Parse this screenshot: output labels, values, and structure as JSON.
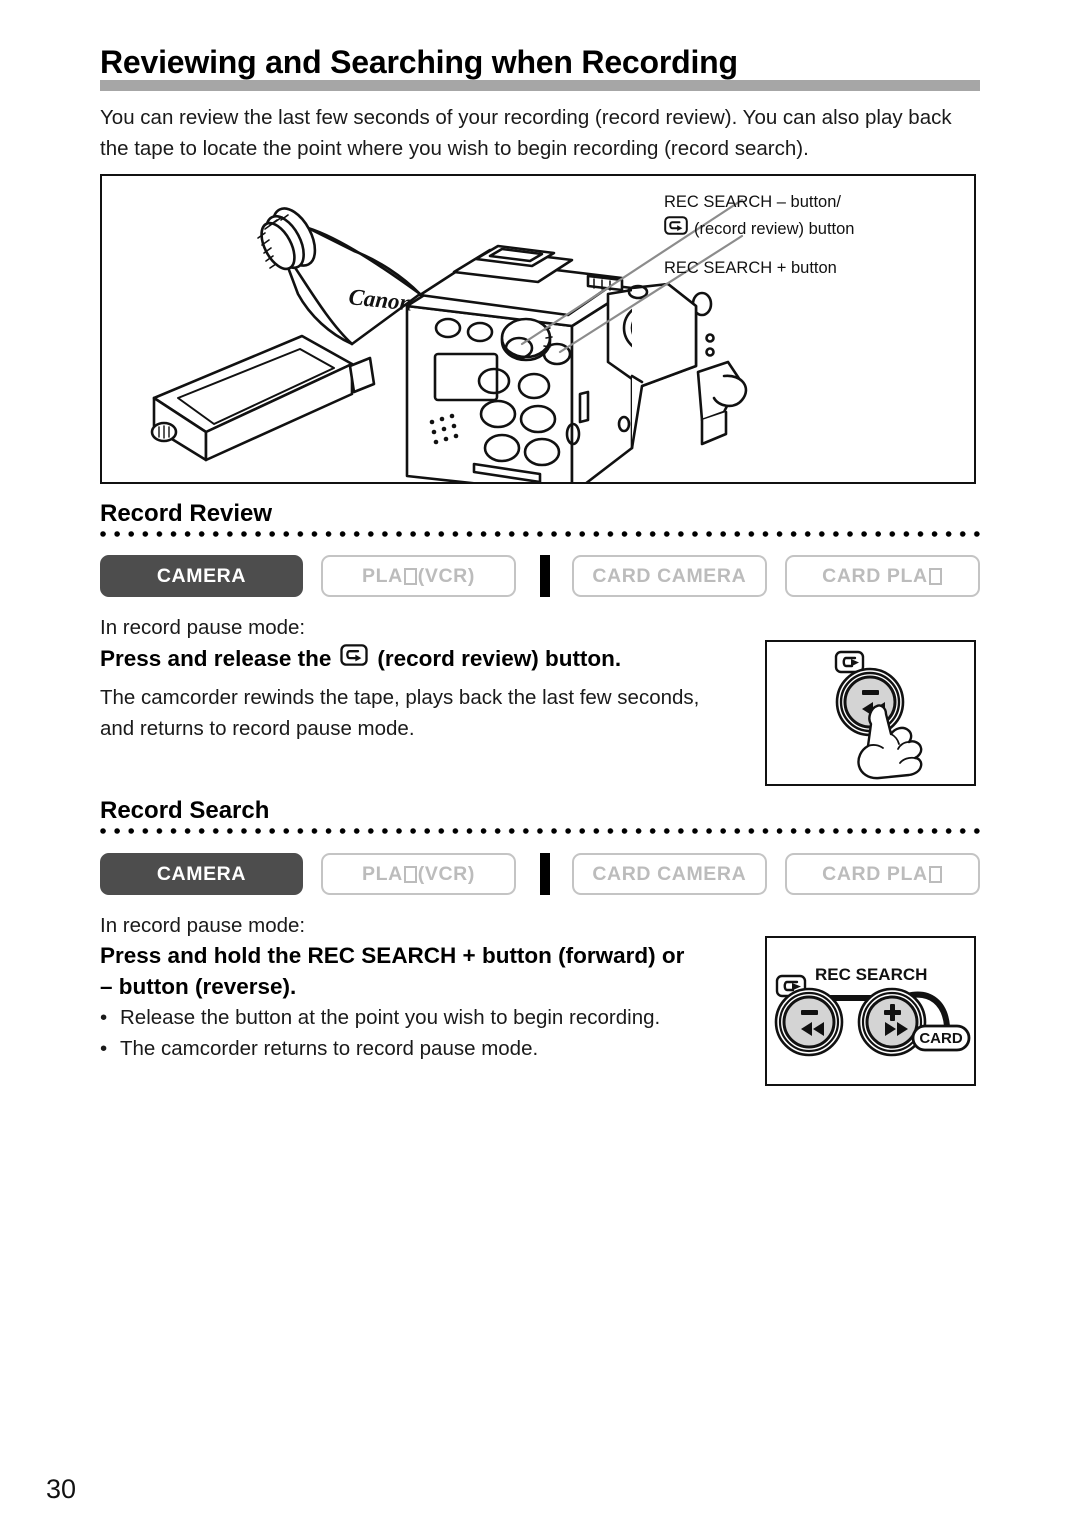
{
  "page": {
    "number": "30",
    "title": "Reviewing and Searching when Recording",
    "intro": "You can review the last few seconds of your recording (record review). You can also play back the tape to locate the point where you wish to begin recording (record search)."
  },
  "figure": {
    "name": "camcorder-illustration",
    "device_brand": "Canon",
    "callouts": [
      {
        "line1": "REC SEARCH – button/",
        "icon": "record-review-glyph",
        "line2": "(record review) button"
      },
      {
        "line1": "REC SEARCH + button"
      }
    ]
  },
  "modes": {
    "camera": "CAMERA",
    "play_prefix": "PLA",
    "play_suffix": " (VCR)",
    "card_camera": "CARD CAMERA",
    "card_play_prefix": "CARD PLA"
  },
  "sections": [
    {
      "heading": "Record Review",
      "condition": "In record pause mode:",
      "step_before_icon": "Press and release the",
      "step_icon": "record-review-glyph",
      "step_after_icon": "(record review) button.",
      "body_lines": [
        "The camcorder rewinds the tape, plays back the last few seconds,",
        "and returns to record pause mode."
      ],
      "illustration": {
        "name": "record-review-button-illustration",
        "glyph": "record-review-glyph",
        "button_minus": "−",
        "button_rewind": "rewind-icon",
        "hand": "pointing-hand-icon"
      }
    },
    {
      "heading": "Record Search",
      "condition": "In record pause mode:",
      "step_lines": [
        "Press and hold the REC SEARCH + button (forward) or",
        "– button (reverse)."
      ],
      "bullets": [
        "Release the button at the point you wish to begin recording.",
        "The camcorder returns to record pause mode."
      ],
      "illustration": {
        "name": "rec-search-buttons-illustration",
        "label": "REC SEARCH",
        "glyph": "record-review-glyph",
        "minus": "−",
        "plus": "+",
        "card_label": "CARD"
      }
    }
  ],
  "colors": {
    "title_rule": "#a6a6a6",
    "active_badge_bg": "#4d4d4d",
    "inactive_badge_border": "#c4c4c4",
    "inactive_badge_text": "#bcbcbc",
    "button_fill": "#d4d4d4"
  }
}
